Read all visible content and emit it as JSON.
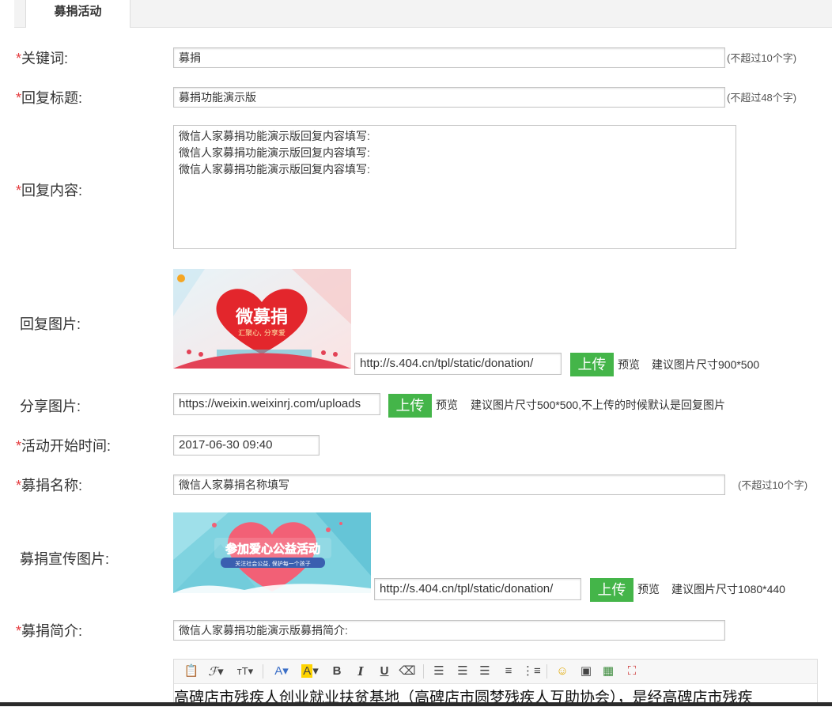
{
  "tab": {
    "label": "募捐活动"
  },
  "required_mark": "*",
  "fields": {
    "keyword": {
      "label": "关键词:",
      "value": "募捐",
      "hint": "(不超过10个字)"
    },
    "reply_title": {
      "label": "回复标题:",
      "value": "募捐功能演示版",
      "hint": "(不超过48个字)"
    },
    "reply_content": {
      "label": "回复内容:",
      "lines": [
        "微信人家募捐功能演示版回复内容填写:",
        "微信人家募捐功能演示版回复内容填写:",
        "微信人家募捐功能演示版回复内容填写:"
      ]
    },
    "reply_image": {
      "label": "回复图片:",
      "url": "http://s.404.cn/tpl/static/donation/",
      "upload": "上传",
      "preview": "预览",
      "hint": "建议图片尺寸900*500",
      "banner_title": "微募捐",
      "banner_sub": "汇聚心, 分享爱"
    },
    "share_image": {
      "label": "分享图片:",
      "url": "https://weixin.weixinrj.com/uploads",
      "upload": "上传",
      "preview": "预览",
      "hint": "建议图片尺寸500*500,不上传的时候默认是回复图片"
    },
    "start_time": {
      "label": "活动开始时间:",
      "value": "2017-06-30 09:40"
    },
    "donation_name": {
      "label": "募捐名称:",
      "value": "微信人家募捐名称填写",
      "hint": "(不超过10个字)"
    },
    "promo_image": {
      "label": "募捐宣传图片:",
      "url": "http://s.404.cn/tpl/static/donation/",
      "upload": "上传",
      "preview": "预览",
      "hint": "建议图片尺寸1080*440",
      "banner_title": "参加爱心公益活动",
      "banner_sub": "关注社会公益, 保护每一个孩子"
    },
    "intro": {
      "label": "募捐简介:",
      "value": "微信人家募捐功能演示版募捐简介:"
    }
  },
  "editor": {
    "tools": [
      "paste-text-icon",
      "font-family-icon",
      "font-size-icon",
      "font-color-icon",
      "bg-color-icon",
      "bold-icon",
      "italic-icon",
      "underline-icon",
      "eraser-icon",
      "align-left-icon",
      "align-center-icon",
      "align-right-icon",
      "ordered-list-icon",
      "unordered-list-icon",
      "emoji-icon",
      "insert-image-icon",
      "multi-image-icon",
      "fullscreen-icon"
    ],
    "content": "高碑店市残疾人创业就业扶贫基地（高碑店市圆梦残疾人互助协会），是经高碑店市残疾"
  },
  "colors": {
    "accent": "#44b549",
    "required": "#e4393c"
  }
}
